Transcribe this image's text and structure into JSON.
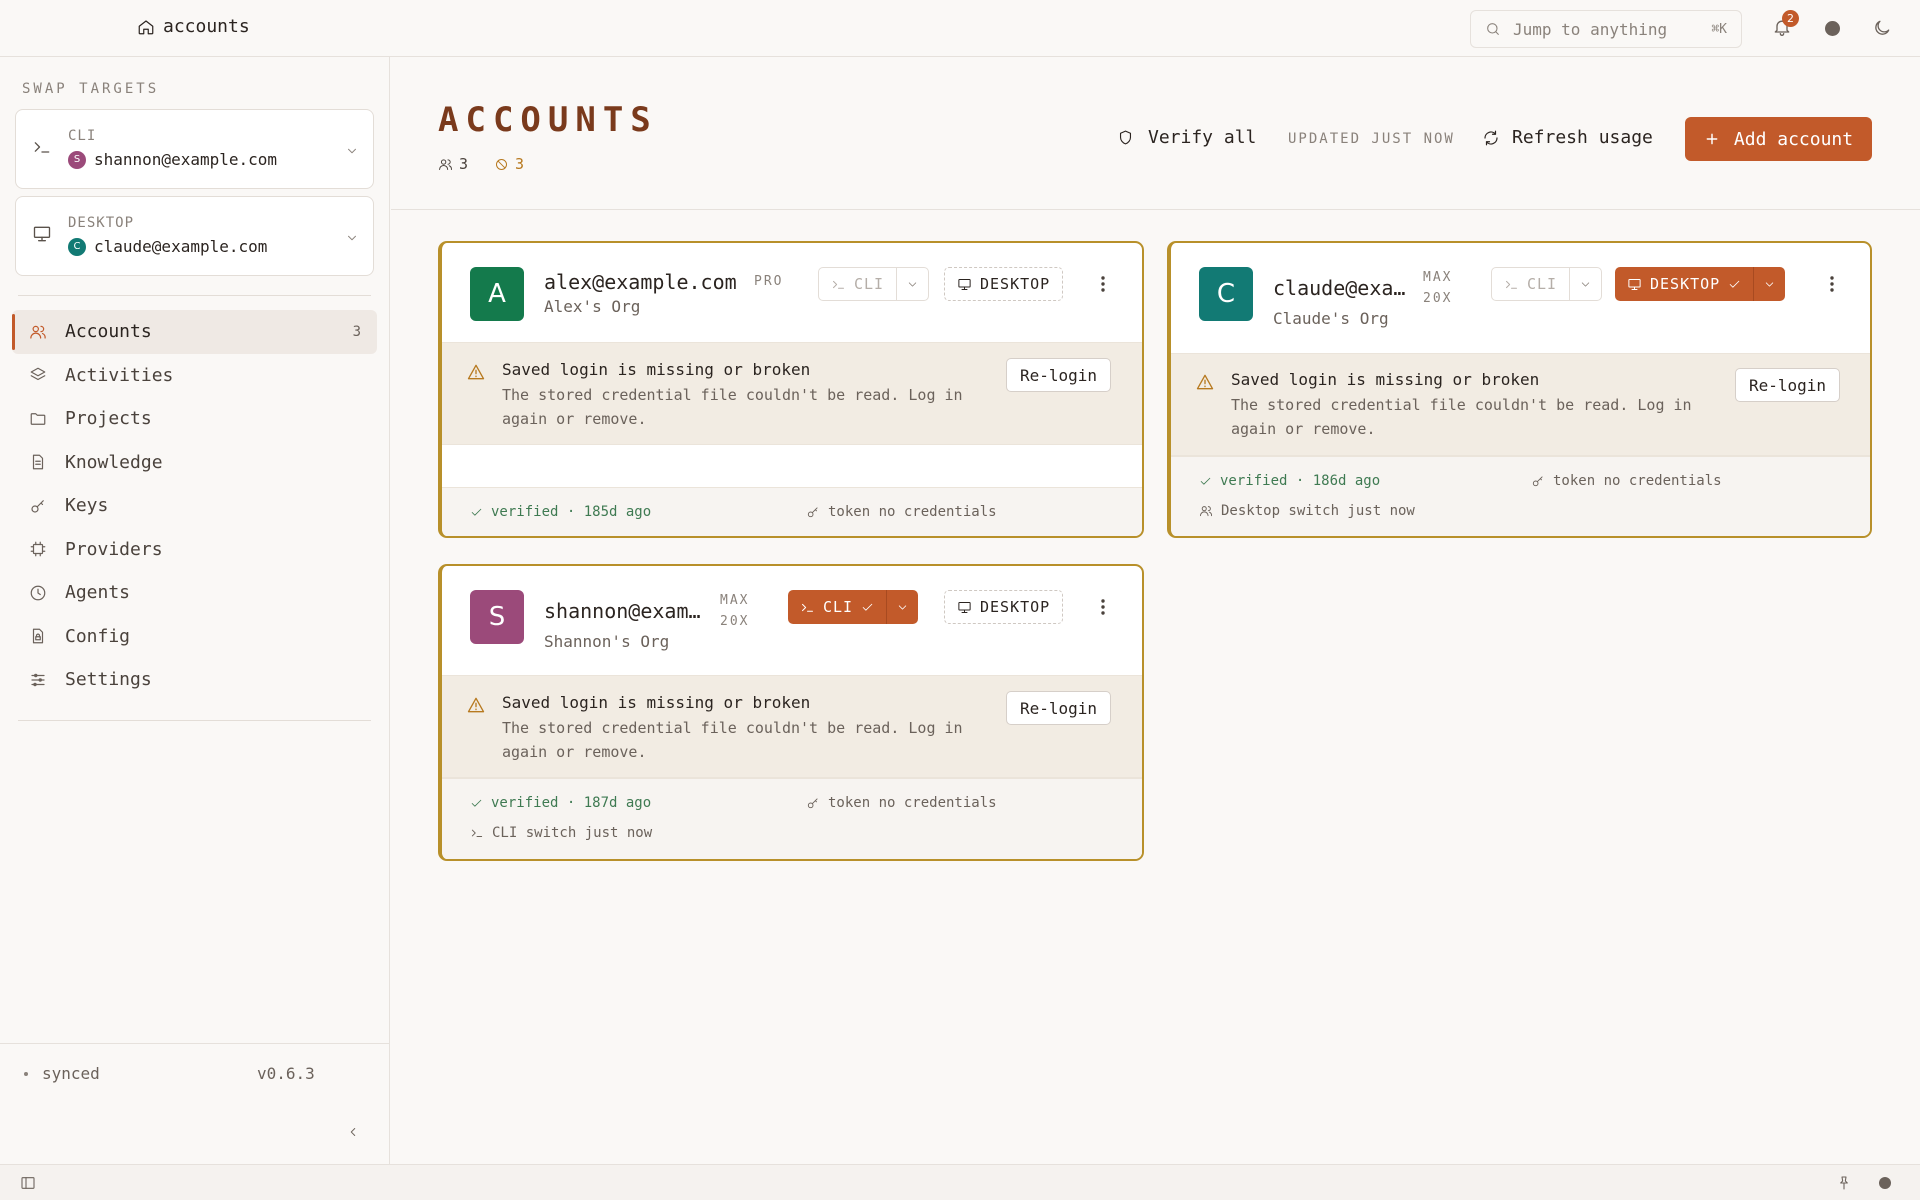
{
  "topbar": {
    "breadcrumb": "accounts",
    "search_placeholder": "Jump to anything",
    "search_shortcut": "⌘K",
    "notification_count": "2"
  },
  "sidebar": {
    "section_title": "SWAP TARGETS",
    "targets": [
      {
        "label": "CLI",
        "account": "shannon@example.com",
        "avatar_letter": "S",
        "avatar_color": "#9b4a7a"
      },
      {
        "label": "DESKTOP",
        "account": "claude@example.com",
        "avatar_letter": "C",
        "avatar_color": "#127a74"
      }
    ],
    "nav": [
      {
        "label": "Accounts",
        "count": "3",
        "icon": "users-icon"
      },
      {
        "label": "Activities",
        "icon": "layers-icon"
      },
      {
        "label": "Projects",
        "icon": "folder-icon"
      },
      {
        "label": "Knowledge",
        "icon": "document-icon"
      },
      {
        "label": "Keys",
        "icon": "key-icon"
      },
      {
        "label": "Providers",
        "icon": "chip-icon"
      },
      {
        "label": "Agents",
        "icon": "clock-icon"
      },
      {
        "label": "Config",
        "icon": "file-lock-icon"
      },
      {
        "label": "Settings",
        "icon": "sliders-icon"
      }
    ],
    "footer": {
      "status": "synced",
      "version": "v0.6.3"
    }
  },
  "header": {
    "title": "ACCOUNTS",
    "accounts_count": "3",
    "broken_count": "3",
    "verify_all": "Verify all",
    "updated": "UPDATED JUST NOW",
    "refresh": "Refresh usage",
    "add_account": "Add account"
  },
  "accent_color": "#c25a2a",
  "warning_border_color": "#b8902a",
  "cards": [
    {
      "avatar_letter": "A",
      "avatar_color": "#147a4c",
      "email": "alex@example.com",
      "plan_line1": "PRO",
      "plan_line2": "",
      "org": "Alex's Org",
      "cli_label": "CLI",
      "cli_active": false,
      "desktop_label": "DESKTOP",
      "desktop_active": false,
      "warning_title": "Saved login is missing or broken",
      "warning_body": "The stored credential file couldn't be read. Log in again or remove.",
      "relogin": "Re-login",
      "verified": "verified · 185d ago",
      "token": "token no credentials",
      "switch_note": ""
    },
    {
      "avatar_letter": "C",
      "avatar_color": "#127a74",
      "email": "claude@example.com",
      "plan_line1": "MAX",
      "plan_line2": "20X",
      "org": "Claude's Org",
      "cli_label": "CLI",
      "cli_active": false,
      "desktop_label": "DESKTOP",
      "desktop_active": true,
      "warning_title": "Saved login is missing or broken",
      "warning_body": "The stored credential file couldn't be read. Log in again or remove.",
      "relogin": "Re-login",
      "verified": "verified · 186d ago",
      "token": "token no credentials",
      "switch_note": "Desktop switch just now"
    },
    {
      "avatar_letter": "S",
      "avatar_color": "#9b4a7a",
      "email": "shannon@example.com",
      "plan_line1": "MAX",
      "plan_line2": "20X",
      "org": "Shannon's Org",
      "cli_label": "CLI",
      "cli_active": true,
      "desktop_label": "DESKTOP",
      "desktop_active": false,
      "warning_title": "Saved login is missing or broken",
      "warning_body": "The stored credential file couldn't be read. Log in again or remove.",
      "relogin": "Re-login",
      "verified": "verified · 187d ago",
      "token": "token no credentials",
      "switch_note": "CLI switch just now"
    }
  ]
}
